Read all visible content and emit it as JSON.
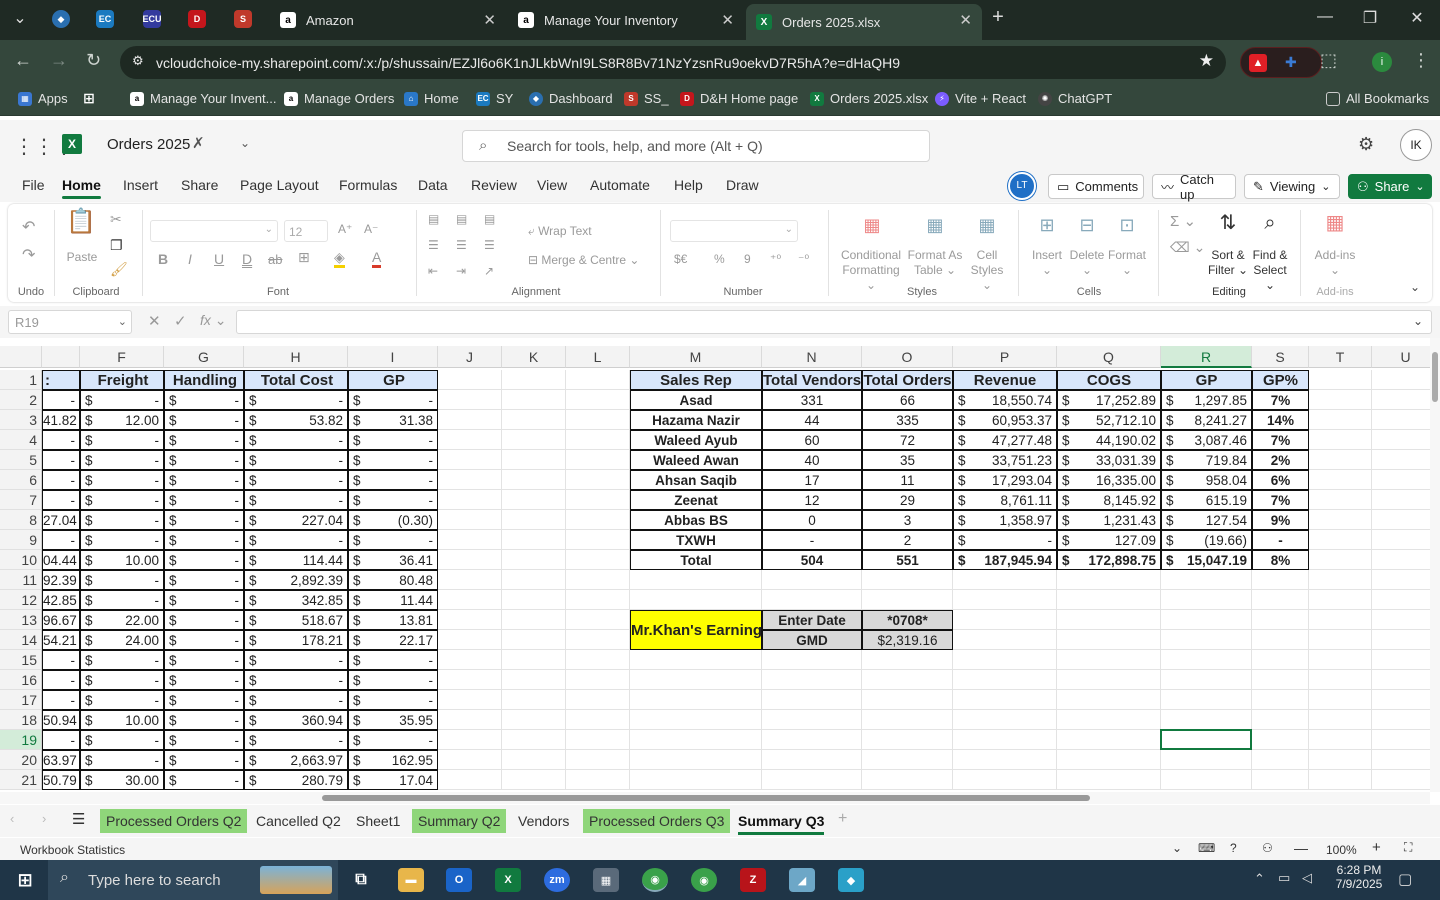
{
  "browser": {
    "tabs": [
      {
        "label": "Amazon"
      },
      {
        "label": "Manage Your Inventory"
      },
      {
        "label": "Orders 2025.xlsx"
      }
    ],
    "url": "vcloudchoice-my.sharepoint.com/:x:/p/shussain/EZJl6o6K1nJLkbWnI9LS8R8Bv71NzYzsnRu9oekvD7R5hA?e=dHaQH9",
    "bookmarks": [
      "Apps",
      "Manage Your Invent...",
      "Manage Orders",
      "Home",
      "SY",
      "Dashboard",
      "SS_",
      "D&H Home page",
      "Orders 2025.xlsx",
      "Vite + React",
      "ChatGPT"
    ],
    "all_bookmarks": "All Bookmarks",
    "pinned_labels": [
      "EC",
      "ECU"
    ]
  },
  "excel": {
    "title": "Orders 2025",
    "search_placeholder": "Search for tools, help, and more (Alt + Q)",
    "avatar": "IK",
    "presence": "LT",
    "menus": [
      "File",
      "Home",
      "Insert",
      "Share",
      "Page Layout",
      "Formulas",
      "Data",
      "Review",
      "View",
      "Automate",
      "Help",
      "Draw"
    ],
    "comments": "Comments",
    "catchup": "Catch up",
    "viewing": "Viewing",
    "share": "Share",
    "ribbon": {
      "groups": [
        "Undo",
        "Clipboard",
        "Font",
        "Alignment",
        "Number",
        "Styles",
        "Cells",
        "Editing",
        "Add-ins"
      ],
      "paste": "Paste",
      "font_size": "12",
      "wrap": "Wrap Text",
      "merge": "Merge & Centre",
      "cond": [
        "Conditional",
        "Formatting"
      ],
      "fmt_table": [
        "Format As",
        "Table"
      ],
      "cell_styles": [
        "Cell",
        "Styles"
      ],
      "insert": "Insert",
      "delete": "Delete",
      "format": "Format",
      "sort": [
        "Sort &",
        "Filter"
      ],
      "find": [
        "Find &",
        "Select"
      ],
      "addins": "Add-ins",
      "font_buttons": [
        "B",
        "I",
        "U",
        "D"
      ],
      "number_buttons": [
        "$€",
        "%",
        "9"
      ]
    },
    "name_box": "R19",
    "columns": [
      "F",
      "G",
      "H",
      "I",
      "J",
      "K",
      "L",
      "M",
      "N",
      "O",
      "P",
      "Q",
      "R",
      "S",
      "T",
      "U"
    ],
    "first_column_partial": ":",
    "rows": [
      "1",
      "2",
      "3",
      "4",
      "5",
      "6",
      "7",
      "8",
      "9",
      "10",
      "11",
      "12",
      "13",
      "14",
      "15",
      "16",
      "17",
      "18",
      "19",
      "20",
      "21"
    ],
    "left_table": {
      "headers": [
        "Freight",
        "Handling",
        "Total Cost",
        "GP"
      ],
      "rows": [
        [
          "-",
          "-",
          "-",
          "-",
          "-"
        ],
        [
          "41.82",
          "12.00",
          "-",
          "53.82",
          "31.38"
        ],
        [
          "-",
          "-",
          "-",
          "-",
          "-"
        ],
        [
          "-",
          "-",
          "-",
          "-",
          "-"
        ],
        [
          "-",
          "-",
          "-",
          "-",
          "-"
        ],
        [
          "-",
          "-",
          "-",
          "-",
          "-"
        ],
        [
          "27.04",
          "-",
          "-",
          "227.04",
          "(0.30)"
        ],
        [
          "-",
          "-",
          "-",
          "-",
          "-"
        ],
        [
          "04.44",
          "10.00",
          "-",
          "114.44",
          "36.41"
        ],
        [
          "92.39",
          "-",
          "-",
          "2,892.39",
          "80.48"
        ],
        [
          "42.85",
          "-",
          "-",
          "342.85",
          "11.44"
        ],
        [
          "96.67",
          "22.00",
          "-",
          "518.67",
          "13.81"
        ],
        [
          "54.21",
          "24.00",
          "-",
          "178.21",
          "22.17"
        ],
        [
          "-",
          "-",
          "-",
          "-",
          "-"
        ],
        [
          "-",
          "-",
          "-",
          "-",
          "-"
        ],
        [
          "-",
          "-",
          "-",
          "-",
          "-"
        ],
        [
          "50.94",
          "10.00",
          "-",
          "360.94",
          "35.95"
        ],
        [
          "-",
          "-",
          "-",
          "-",
          "-"
        ],
        [
          "63.97",
          "-",
          "-",
          "2,663.97",
          "162.95"
        ],
        [
          "50.79",
          "30.00",
          "-",
          "280.79",
          "17.04"
        ]
      ]
    },
    "summary": {
      "headers": [
        "Sales Rep",
        "Total Vendors",
        "Total Orders",
        "Revenue",
        "COGS",
        "GP",
        "GP%"
      ],
      "rows": [
        [
          "Asad",
          "331",
          "66",
          "18,550.74",
          "17,252.89",
          "1,297.85",
          "7%"
        ],
        [
          "Hazama Nazir",
          "44",
          "335",
          "60,953.37",
          "52,712.10",
          "8,241.27",
          "14%"
        ],
        [
          "Waleed Ayub",
          "60",
          "72",
          "47,277.48",
          "44,190.02",
          "3,087.46",
          "7%"
        ],
        [
          "Waleed Awan",
          "40",
          "35",
          "33,751.23",
          "33,031.39",
          "719.84",
          "2%"
        ],
        [
          "Ahsan Saqib",
          "17",
          "11",
          "17,293.04",
          "16,335.00",
          "958.04",
          "6%"
        ],
        [
          "Zeenat",
          "12",
          "29",
          "8,761.11",
          "8,145.92",
          "615.19",
          "7%"
        ],
        [
          "Abbas BS",
          "0",
          "3",
          "1,358.97",
          "1,231.43",
          "127.54",
          "9%"
        ],
        [
          "TXWH",
          "-",
          "2",
          "-",
          "127.09",
          "(19.66)",
          "-"
        ]
      ],
      "total": [
        "Total",
        "504",
        "551",
        "187,945.94",
        "172,898.75",
        "15,047.19",
        "8%"
      ]
    },
    "earning": {
      "label": "Mr.Khan's Earning",
      "enter_date": "Enter Date",
      "date_value": "*0708*",
      "gmd": "GMD",
      "gmd_value": "$2,319.16"
    },
    "currency": "$",
    "sheets": [
      {
        "label": "Processed Orders Q2",
        "green": true
      },
      {
        "label": "Cancelled Q2",
        "green": false
      },
      {
        "label": "Sheet1",
        "green": false
      },
      {
        "label": "Summary Q2",
        "green": true
      },
      {
        "label": "Vendors",
        "green": false
      },
      {
        "label": "Processed Orders Q3",
        "green": true
      },
      {
        "label": "Summary Q3",
        "green": false,
        "active": true
      }
    ],
    "status_left": "Workbook Statistics",
    "zoom": "100%"
  },
  "taskbar": {
    "search": "Type here to search",
    "time": "6:28 PM",
    "date": "7/9/2025"
  },
  "colors": {
    "accent": "#117a3f",
    "header_fill": "#d9e7fb",
    "green_tab": "#8fd67a",
    "yellow": "#ffff00",
    "grey": "#d9d9d9"
  }
}
